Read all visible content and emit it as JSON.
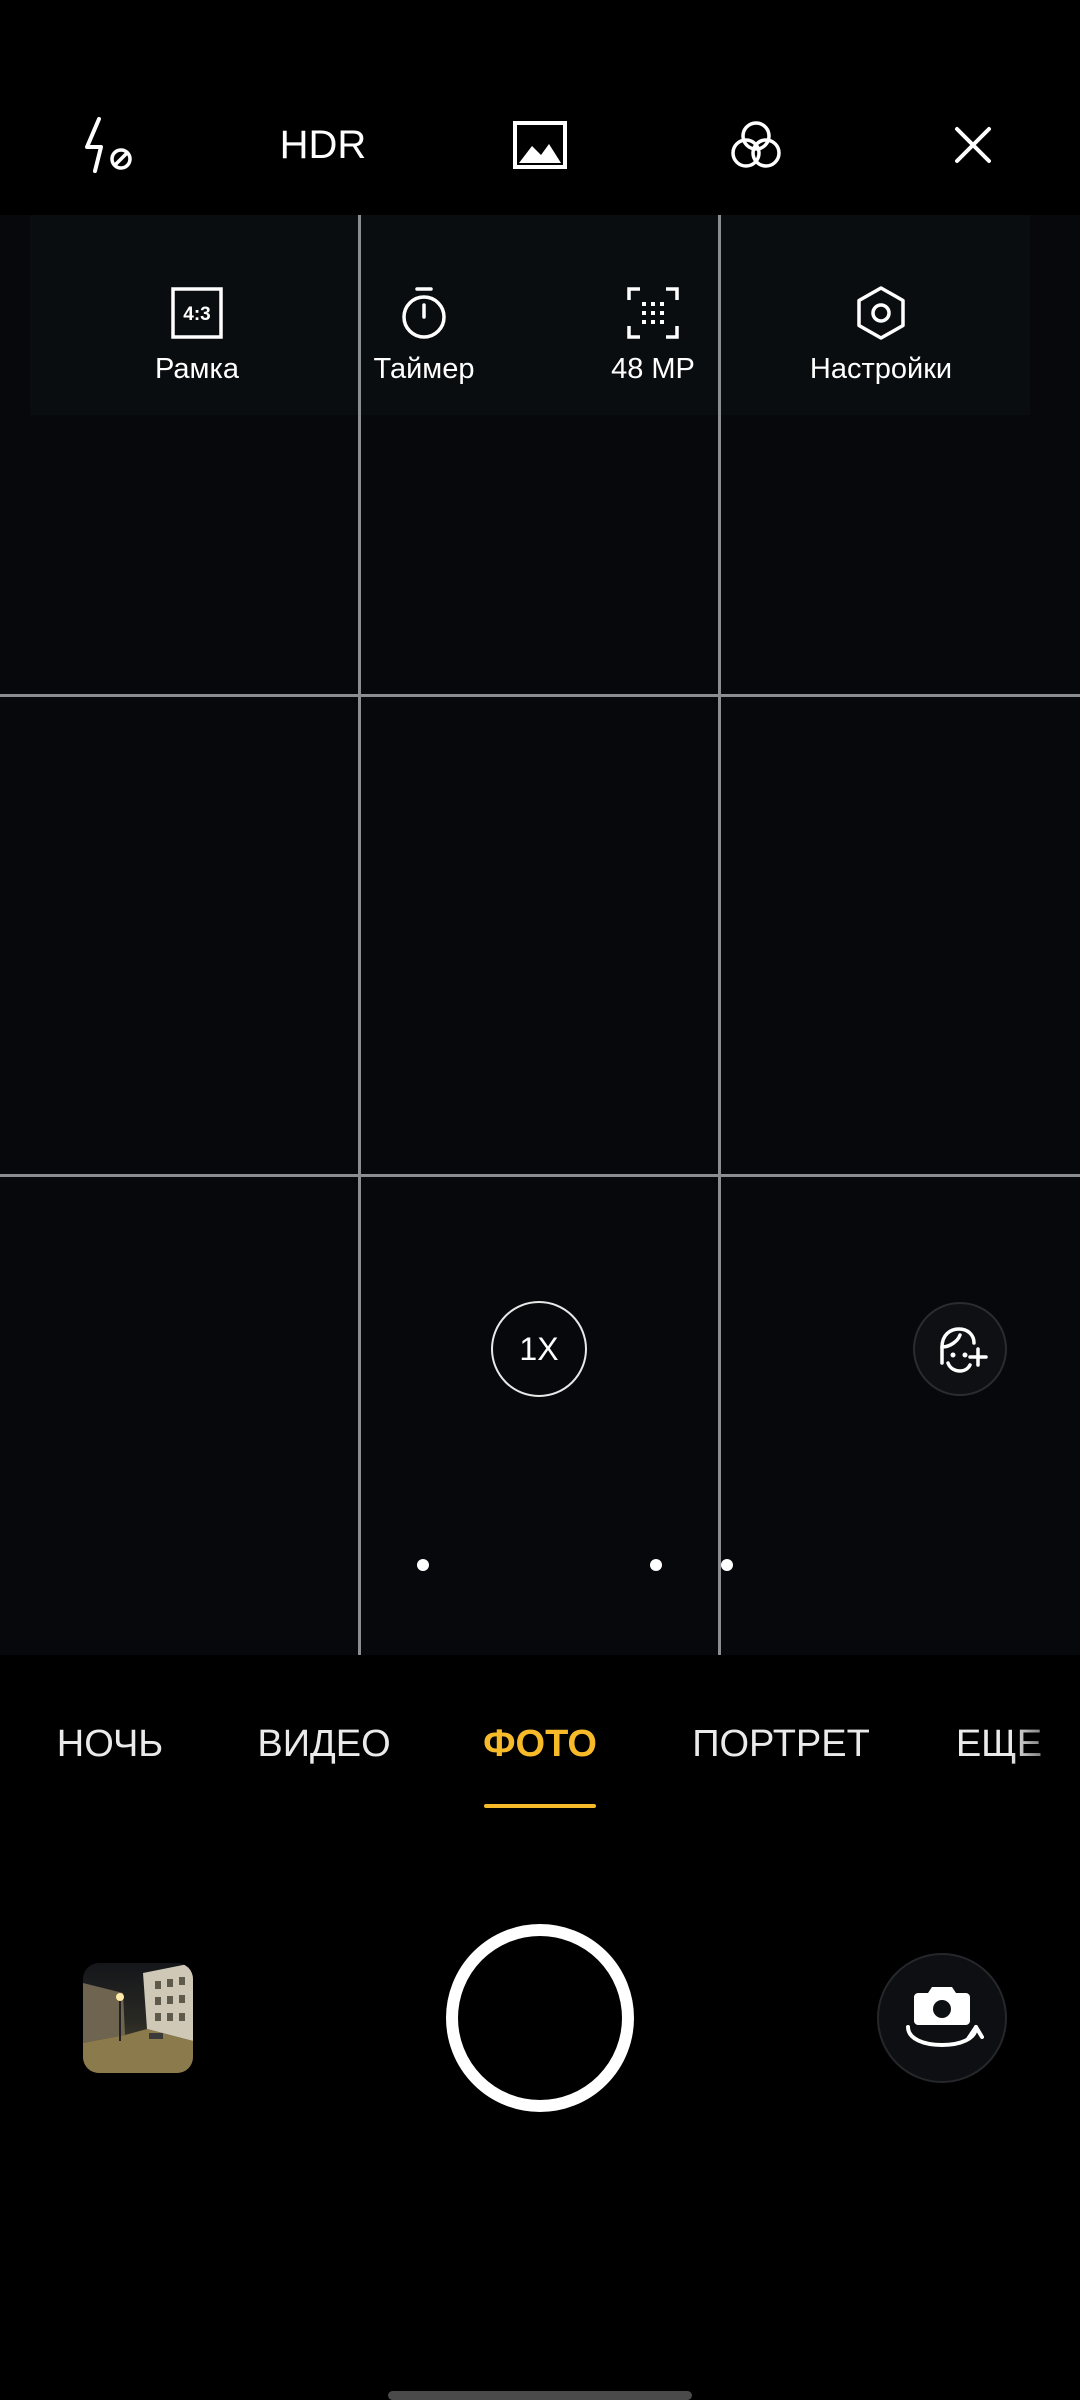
{
  "top_bar": {
    "flash_icon": "flash-off-icon",
    "hdr_label": "HDR",
    "image_icon": "image-icon",
    "filter_icon": "filter-circles-icon",
    "close_icon": "close-icon"
  },
  "quick_settings": {
    "frame": {
      "icon_text": "4:3",
      "label": "Рамка"
    },
    "timer": {
      "label": "Таймер"
    },
    "resolution": {
      "label": "48 MP"
    },
    "settings": {
      "label": "Настройки"
    }
  },
  "zoom": {
    "label": "1X"
  },
  "modes": {
    "items": [
      "НОЧЬ",
      "ВИДЕО",
      "ФОТО",
      "ПОРТРЕТ",
      "ЕЩЕ"
    ],
    "active": "ФОТО"
  },
  "colors": {
    "accent": "#f7bb2a",
    "background": "#000000",
    "viewfinder": "#06080c",
    "grid": "#8b8d91"
  }
}
